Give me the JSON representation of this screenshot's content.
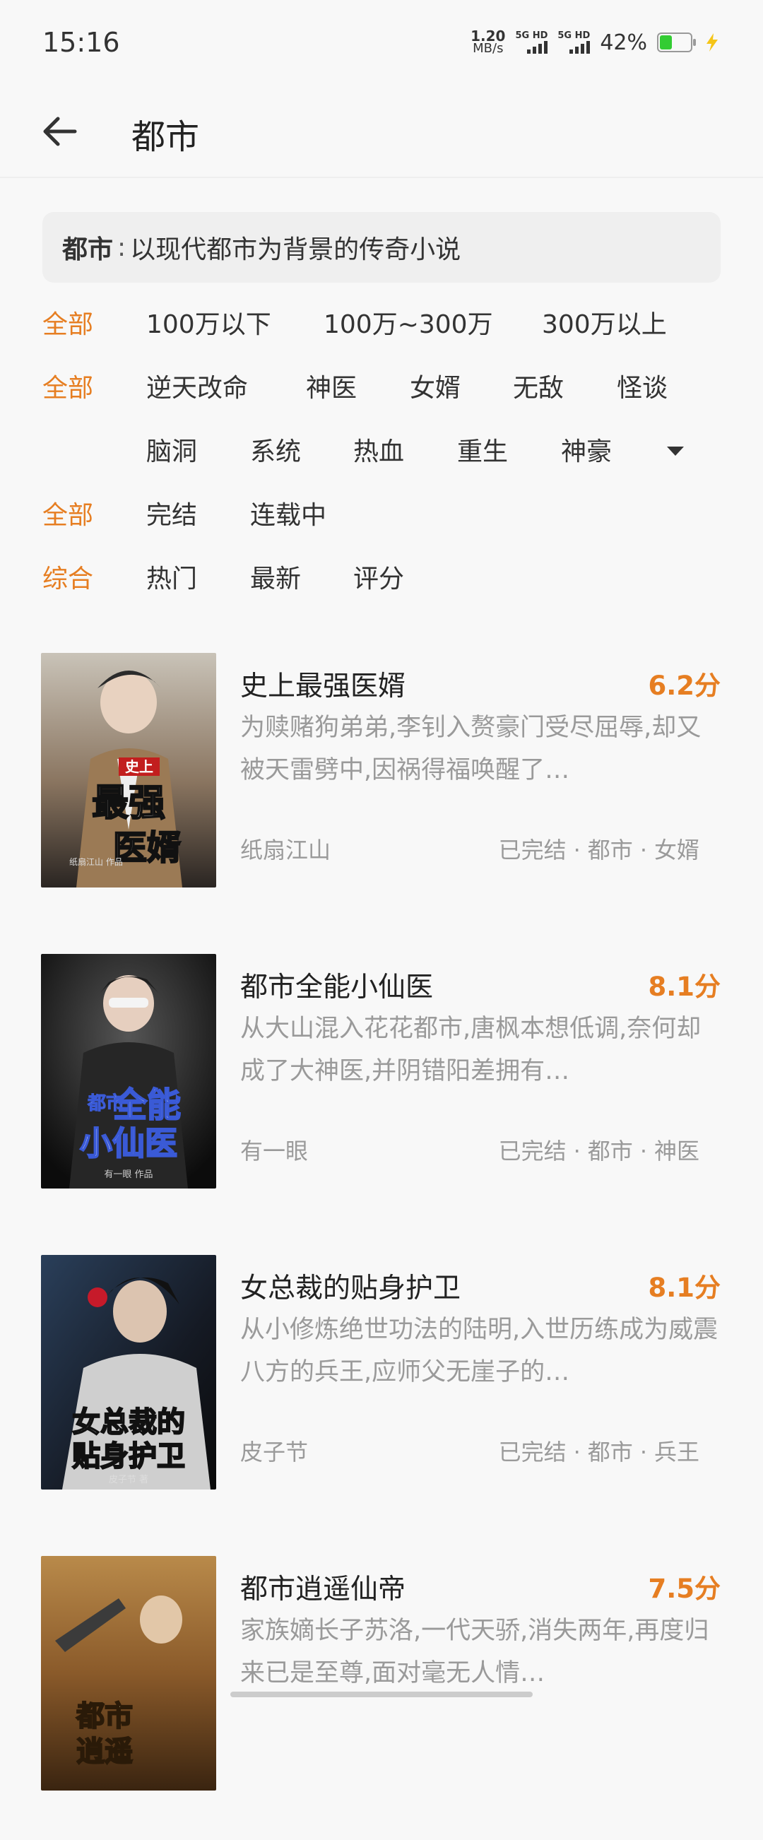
{
  "status_bar": {
    "time": "15:16",
    "net_speed_value": "1.20",
    "net_speed_unit": "MB/s",
    "sim1_label": "5G HD",
    "sim2_label": "5G HD",
    "battery_percent": "42%",
    "battery_level": 0.42,
    "charging_icon": "bolt-icon"
  },
  "header": {
    "back_icon": "arrow-left-icon",
    "title": "都市"
  },
  "description": {
    "key": "都市",
    "separator": ":",
    "text": "以现代都市为背景的传奇小说"
  },
  "filters": {
    "word_count": {
      "all": "全部",
      "options": [
        "100万以下",
        "100万~300万",
        "300万以上"
      ]
    },
    "tags": {
      "all": "全部",
      "row1": [
        "逆天改命",
        "神医",
        "女婿",
        "无敌",
        "怪谈"
      ],
      "row2": [
        "脑洞",
        "系统",
        "热血",
        "重生",
        "神豪"
      ],
      "expand_icon": "caret-down-icon"
    },
    "status": {
      "all": "全部",
      "options": [
        "完结",
        "连载中"
      ]
    },
    "sort": {
      "default": "综合",
      "options": [
        "热门",
        "最新",
        "评分"
      ]
    }
  },
  "books": [
    {
      "title": "史上最强医婿",
      "score": "6.2分",
      "description": "为赎赌狗弟弟,李钊入赘豪门受尽屈辱,却又被天雷劈中,因祸得福唤醒了…",
      "author": "纸扇江山",
      "status": "已完结",
      "category": "都市",
      "tag": "女婿",
      "cover": {
        "line1": "史上",
        "line2": "最强",
        "line3": "医婿",
        "credit": "纸扇江山 作品"
      }
    },
    {
      "title": "都市全能小仙医",
      "score": "8.1分",
      "description": "从大山混入花花都市,唐枫本想低调,奈何却成了大神医,并阴错阳差拥有…",
      "author": "有一眼",
      "status": "已完结",
      "category": "都市",
      "tag": "神医",
      "cover": {
        "line1": "都市",
        "line2": "全能",
        "line3": "小仙医",
        "credit": "有一眼 作品"
      }
    },
    {
      "title": "女总裁的贴身护卫",
      "score": "8.1分",
      "description": "从小修炼绝世功法的陆明,入世历练成为威震八方的兵王,应师父无崖子的…",
      "author": "皮子节",
      "status": "已完结",
      "category": "都市",
      "tag": "兵王",
      "cover": {
        "line1": "女总裁的",
        "line2": "贴身护卫",
        "line3": "",
        "credit": "皮子节 著"
      }
    },
    {
      "title": "都市逍遥仙帝",
      "score": "7.5分",
      "description": "家族嫡长子苏洛,一代天骄,消失两年,再度归来已是至尊,面对毫无人情…",
      "author": "",
      "status": "",
      "category": "",
      "tag": "",
      "cover": {
        "line1": "都市",
        "line2": "逍遥",
        "line3": "",
        "credit": ""
      }
    }
  ],
  "colors": {
    "accent": "#e67e22",
    "text_primary": "#222222",
    "text_secondary": "#9a9a9a",
    "background": "#f8f8f8",
    "desc_box": "#efefef"
  }
}
